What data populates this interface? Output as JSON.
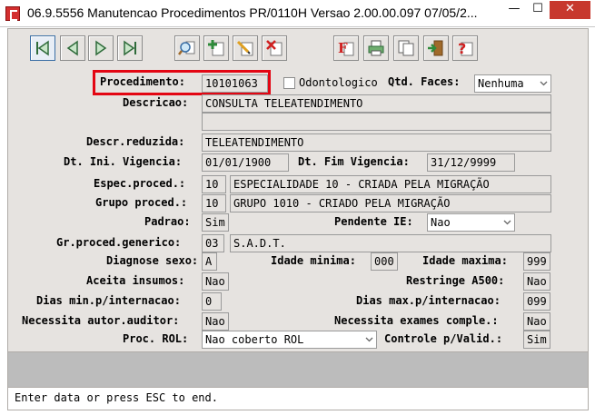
{
  "window": {
    "title": "06.9.5556 Manutencao  Procedimentos PR/0110H Versao 2.00.00.097 07/05/2...",
    "minimize": "—",
    "maximize": "☐",
    "close": "✕"
  },
  "toolbar": {
    "icons": [
      "first-icon",
      "previous-icon",
      "next-icon",
      "last-icon",
      "search-icon",
      "add-icon",
      "edit-icon",
      "delete-icon",
      "filter-icon",
      "print-icon",
      "copy-icon",
      "exit-icon",
      "help-icon"
    ]
  },
  "form": {
    "procedimento": {
      "label": "Procedimento:",
      "value": "10101063"
    },
    "odontologico": {
      "label": "Odontologico",
      "checked": false
    },
    "qtd_faces": {
      "label": "Qtd. Faces:",
      "value": "Nenhuma"
    },
    "descricao": {
      "label": "Descricao:",
      "line1": "CONSULTA TELEATENDIMENTO",
      "line2": ""
    },
    "descr_reduzida": {
      "label": "Descr.reduzida:",
      "value": "TELEATENDIMENTO"
    },
    "dt_ini_vigencia": {
      "label": "Dt. Ini. Vigencia:",
      "value": "01/01/1900"
    },
    "dt_fim_vigencia": {
      "label": "Dt. Fim Vigencia:",
      "value": "31/12/9999"
    },
    "espec_proced": {
      "label": "Espec.proced.:",
      "code": "10",
      "desc": "ESPECIALIDADE 10 - CRIADA PELA MIGRAÇÃO"
    },
    "grupo_proced": {
      "label": "Grupo proced.:",
      "code": "10",
      "desc": "GRUPO 1010 - CRIADO PELA MIGRAÇÃO"
    },
    "padrao": {
      "label": "Padrao:",
      "value": "Sim"
    },
    "pendente_ie": {
      "label": "Pendente IE:",
      "value": "Nao"
    },
    "gr_proced_generico": {
      "label": "Gr.proced.generico:",
      "code": "03",
      "desc": "S.A.D.T."
    },
    "diagnose_sexo": {
      "label": "Diagnose sexo:",
      "value": "A"
    },
    "idade_minima": {
      "label": "Idade minima:",
      "value": "000"
    },
    "idade_maxima": {
      "label": "Idade maxima:",
      "value": "999"
    },
    "aceita_insumos": {
      "label": "Aceita insumos:",
      "value": "Nao"
    },
    "restringe_a500": {
      "label": "Restringe A500:",
      "value": "Nao"
    },
    "dias_min_internacao": {
      "label": "Dias min.p/internacao:",
      "value": "0"
    },
    "dias_max_internacao": {
      "label": "Dias max.p/internacao:",
      "value": "099"
    },
    "necessita_autor_auditor": {
      "label": "Necessita autor.auditor:",
      "value": "Nao"
    },
    "necessita_exames_comple": {
      "label": "Necessita exames comple.:",
      "value": "Nao"
    },
    "proc_rol": {
      "label": "Proc. ROL:",
      "value": "Nao coberto ROL"
    },
    "controle_p_valid": {
      "label": "Controle p/Valid.:",
      "value": "Sim"
    }
  },
  "status": {
    "message": "Enter data or press ESC to end."
  },
  "colors": {
    "panel": "#e6e3e0",
    "highlight": "#e30613",
    "close": "#c7382d"
  }
}
